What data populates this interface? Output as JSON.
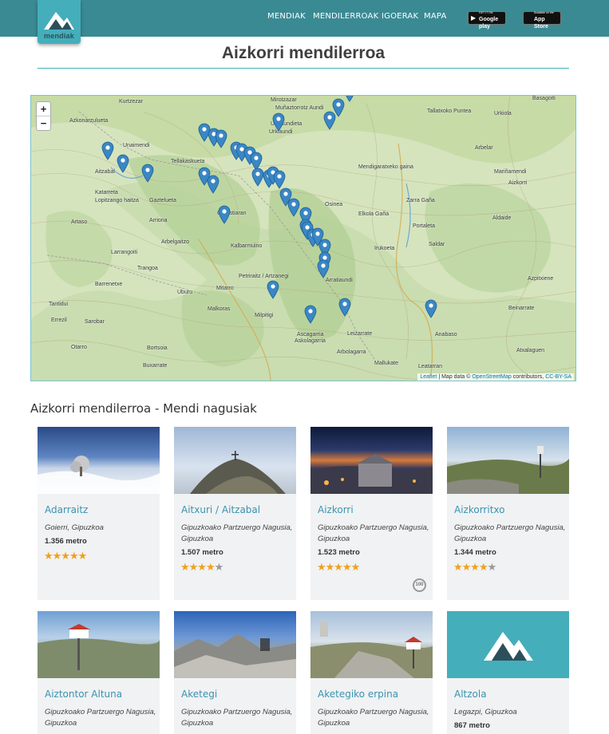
{
  "header": {
    "logo_text": "mendiak",
    "nav": [
      "MENDIAK",
      "MENDILERROAK",
      "IGOERAK",
      "MAPA"
    ],
    "google_play": {
      "small": "GET IT ON",
      "big": "Google play"
    },
    "app_store": {
      "small": "Available on the",
      "big": "App Store"
    }
  },
  "page": {
    "title": "Aizkorri mendilerroa",
    "section_title": "Aizkorri mendilerroa - Mendi nagusiak"
  },
  "map": {
    "zoom_in": "+",
    "zoom_out": "−",
    "attribution": {
      "leaflet": "Leaflet",
      "sep": " | Map data © ",
      "osm": "OpenStreetMap",
      "contributors": " contributors, ",
      "license": "CC-BY-SA"
    },
    "labels": [
      "Kurtzezar",
      "Azkonarzulueta",
      "Unaimendi",
      "Aitzabal",
      "Katarreta",
      "Lopitzango haitza",
      "Tellakaskueta",
      "Gaztelueta",
      "Artaso",
      "Arriona",
      "Arbelgaitzo",
      "Gorostiaran",
      "Larrangoiti",
      "Trangoa",
      "Barrenetxe",
      "Tantidui",
      "Sarobar",
      "Errezil",
      "Otarro",
      "Bortsoia",
      "Buxarrate",
      "Kalbarmuino",
      "Petriraitz / Artzanegi",
      "Uburu",
      "Malkoras",
      "Mitarro",
      "Milpitigi",
      "Ascagarria",
      "Askolagarria",
      "Mirotzazar",
      "Muñaztorrotz Aundi",
      "Urkiaundieta",
      "Urkiaundi",
      "Mendigaratxeko gaina",
      "Zarra Gaña",
      "Osinea",
      "Elkola Gaña",
      "Portaleta",
      "Saldar",
      "Irukoeta",
      "Arbelar",
      "Aldaide",
      "Mariñamendi",
      "Aizkorri",
      "Arratiaundi",
      "Leizarrate",
      "Arbolagarra",
      "Mallukate",
      "Leatarran",
      "Anabaso",
      "Beinarrate",
      "Azpitxiene",
      "Tallatxoko Puntea",
      "Basagoiti",
      "Urkiola",
      "Atxalaguen"
    ]
  },
  "cards": [
    {
      "name": "Adarraitz",
      "location": "Goierri, Gipuzkoa",
      "height": "1.356 metro",
      "rating": 5,
      "badge": ""
    },
    {
      "name": "Aitxuri / Aitzabal",
      "location": "Gipuzkoako Partzuergo Nagusia, Gipuzkoa",
      "height": "1.507 metro",
      "rating": 4.5,
      "badge": ""
    },
    {
      "name": "Aizkorri",
      "location": "Gipuzkoako Partzuergo Nagusia, Gipuzkoa",
      "height": "1.523 metro",
      "rating": 5,
      "badge": "100"
    },
    {
      "name": "Aizkorritxo",
      "location": "Gipuzkoako Partzuergo Nagusia, Gipuzkoa",
      "height": "1.344 metro",
      "rating": 4,
      "badge": ""
    },
    {
      "name": "Aiztontor Altuna",
      "location": "Gipuzkoako Partzuergo Nagusia, Gipuzkoa",
      "height": "",
      "rating": 0,
      "badge": ""
    },
    {
      "name": "Aketegi",
      "location": "Gipuzkoako Partzuergo Nagusia, Gipuzkoa",
      "height": "",
      "rating": 0,
      "badge": ""
    },
    {
      "name": "Aketegiko erpina",
      "location": "Gipuzkoako Partzuergo Nagusia, Gipuzkoa",
      "height": "",
      "rating": 0,
      "badge": ""
    },
    {
      "name": "Altzola",
      "location": "Legazpi, Gipuzkoa",
      "height": "867 metro",
      "rating": 0,
      "badge": ""
    }
  ],
  "colors": {
    "header": "#3a8a94",
    "accent": "#44aebb",
    "link": "#3a93b0",
    "star": "#f0a020",
    "marker": "#3a87c5"
  }
}
